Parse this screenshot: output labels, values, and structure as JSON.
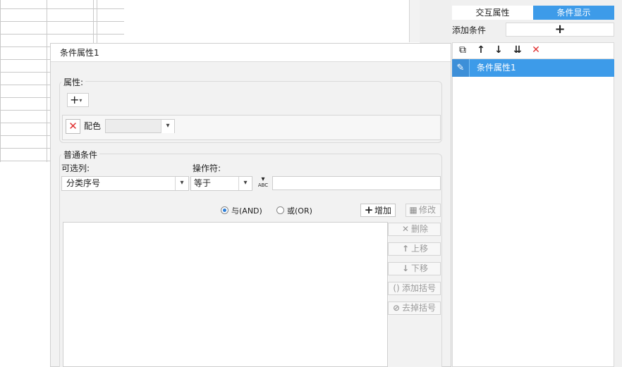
{
  "right_panel": {
    "tabs": [
      "交互属性",
      "条件显示"
    ],
    "add_condition_label": "添加条件",
    "add_condition_icon": "+",
    "toolbar_icons": [
      "copy-icon",
      "arrow-up-icon",
      "arrow-down-icon",
      "move-bottom-icon",
      "delete-icon"
    ],
    "toolbar_glyphs": [
      "⧉",
      "↑",
      "↓",
      "⇊",
      "✕"
    ],
    "selected_item": "条件属性1",
    "selected_item_icon": "✎"
  },
  "dialog": {
    "title": "条件属性1",
    "attribute_group_label": "属性:",
    "add_glyph": "+",
    "dropdown_glyph": "▾",
    "attribute": {
      "delete_glyph": "✕",
      "name": "配色",
      "value": ""
    },
    "normal_condition_label": "普通条件",
    "column_label": "可选列:",
    "column_value": "分类序号",
    "operator_label": "操作符:",
    "operator_value": "等于",
    "formula_icon_glyph": "ABC",
    "value_input": "",
    "logic": {
      "and_label": "与(AND)",
      "or_label": "或(OR)",
      "selected": "and"
    },
    "buttons": {
      "add": "增加",
      "modify": "修改",
      "delete": "删除",
      "move_up": "上移",
      "move_down": "下移",
      "add_bracket": "添加括号",
      "remove_bracket": "去掉括号"
    },
    "button_glyphs": {
      "add": "+",
      "modify": "▦",
      "delete": "✕",
      "move_up": "↑",
      "move_down": "↓",
      "add_bracket": "()",
      "remove_bracket": "⊘"
    }
  },
  "colors": {
    "accent": "#3d9be9",
    "delete": "#e03131"
  }
}
